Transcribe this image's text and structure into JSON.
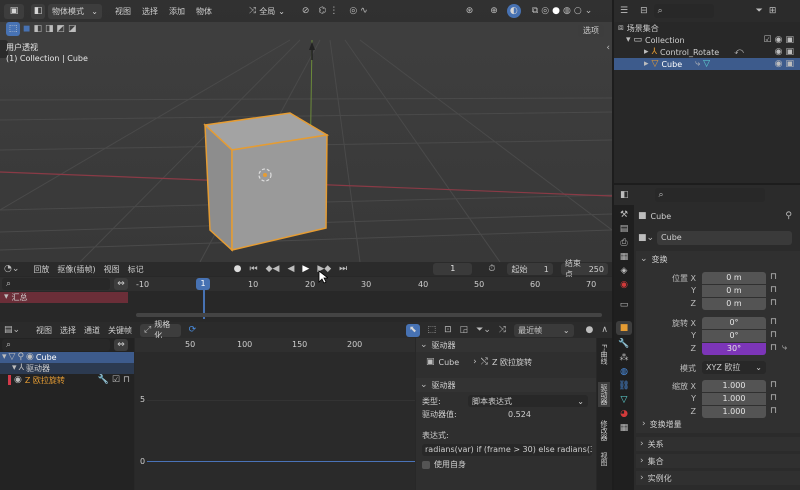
{
  "viewport": {
    "mode": "物体模式",
    "menus": [
      "视图",
      "选择",
      "添加",
      "物体"
    ],
    "orientation": "全局",
    "options": "选项",
    "view_name": "用户透视",
    "collection_label": "(1) Collection | Cube"
  },
  "outliner": {
    "scene_collection": "场景集合",
    "items": [
      "Collection",
      "Control_Rotate",
      "Cube"
    ]
  },
  "properties": {
    "object_name": "Cube",
    "data_name": "Cube",
    "transform_header": "变换",
    "location": {
      "label": "位置 X",
      "y": "Y",
      "z": "Z",
      "values": [
        "0 m",
        "0 m",
        "0 m"
      ]
    },
    "rotation": {
      "label": "旋转 X",
      "y": "Y",
      "z": "Z",
      "values": [
        "0°",
        "0°",
        "30°"
      ]
    },
    "mode_label": "模式",
    "mode_value": "XYZ 欧拉",
    "scale": {
      "label": "缩放 X",
      "y": "Y",
      "z": "Z",
      "values": [
        "1.000",
        "1.000",
        "1.000"
      ]
    },
    "delta_transform": "变换增量",
    "relations": "关系",
    "collections": "集合",
    "instancing": "实例化"
  },
  "timeline": {
    "menus": [
      "回放",
      "抠像(插帧)",
      "视图",
      "标记"
    ],
    "current_frame": "1",
    "start_label": "起始",
    "start_value": "1",
    "end_label": "结束点",
    "end_value": "250",
    "summary": "汇总",
    "ruler": [
      "-10",
      "1",
      "10",
      "20",
      "30",
      "40",
      "50",
      "60",
      "70"
    ],
    "playhead": "1"
  },
  "drivers": {
    "menus": [
      "视图",
      "选择",
      "通道",
      "关键帧"
    ],
    "normalize": "规格化",
    "recent": "最近帧",
    "channels": [
      "Cube",
      "驱动器",
      "Z 欧拉旋转"
    ],
    "ruler": [
      "50",
      "100",
      "150",
      "200"
    ],
    "y_ticks": [
      "5",
      "0"
    ],
    "sidebar": {
      "driven_header": "驱动器",
      "driven_object": "Cube",
      "driven_property": "Z 欧拉旋转",
      "driver_header": "驱动器",
      "type_label": "类型:",
      "type_value": "脚本表达式",
      "value_label": "驱动器值:",
      "value": "0.524",
      "expr_label": "表达式:",
      "expression": "radians(var) if (frame > 30) else radians(30)",
      "use_self": "使用自身"
    },
    "tabs": [
      "F-曲线",
      "驱动器",
      "修改器",
      "视图"
    ]
  },
  "colors": {
    "accent": "#e59c33",
    "selection": "#3d5b8c",
    "rotation_z": "#7c35b8"
  }
}
